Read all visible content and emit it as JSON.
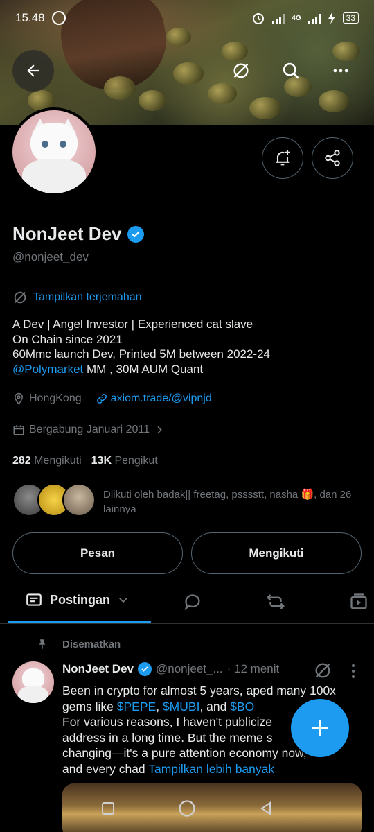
{
  "status_bar": {
    "time": "15.48",
    "network": "4G",
    "battery": "33"
  },
  "profile": {
    "name": "NonJeet Dev",
    "handle": "@nonjeet_dev",
    "translate_label": "Tampilkan terjemahan",
    "bio_lines": [
      "A Dev | Angel Investor | Experienced cat slave",
      "On Chain since 2021",
      "60Mmc launch Dev, Printed 5M between 2022-24"
    ],
    "bio_mention": "@Polymarket",
    "bio_mention_suffix": " MM , 30M AUM Quant",
    "location": "HongKong",
    "website": "axiom.trade/@vipnjd",
    "joined": "Bergabung Januari 2011",
    "following_count": "282",
    "following_label": "Mengikuti",
    "followers_count": "13K",
    "followers_label": "Pengikut",
    "followed_by": "Diikuti oleh badak|| freetag, psssstt, nasha 🎁, dan 26 lainnya"
  },
  "actions": {
    "message_label": "Pesan",
    "following_label": "Mengikuti"
  },
  "tabs": {
    "active_label": "Postingan"
  },
  "post": {
    "pinned_label": "Disematkan",
    "author_name": "NonJeet Dev",
    "author_handle": "@nonjeet_...",
    "time": "· 12 menit",
    "text_1": "Been in crypto for almost 5 years, aped many 100x gems like ",
    "tag_1": "$PEPE",
    "sep_1": ", ",
    "tag_2": "$MUBI",
    "sep_2": ", and ",
    "tag_3": "$BO",
    "text_2": "For various reasons, I haven't publicize",
    "text_3": "address in a long time. But the meme s",
    "text_4": "changing—it's a pure attention economy",
    "text_4b": " now,",
    "text_5": "and every chad ",
    "show_more": "Tampilkan lebih banyak"
  },
  "colors": {
    "accent": "#1d9bf0",
    "muted": "#71767b",
    "text": "#e7e9ea",
    "border": "#536471"
  }
}
